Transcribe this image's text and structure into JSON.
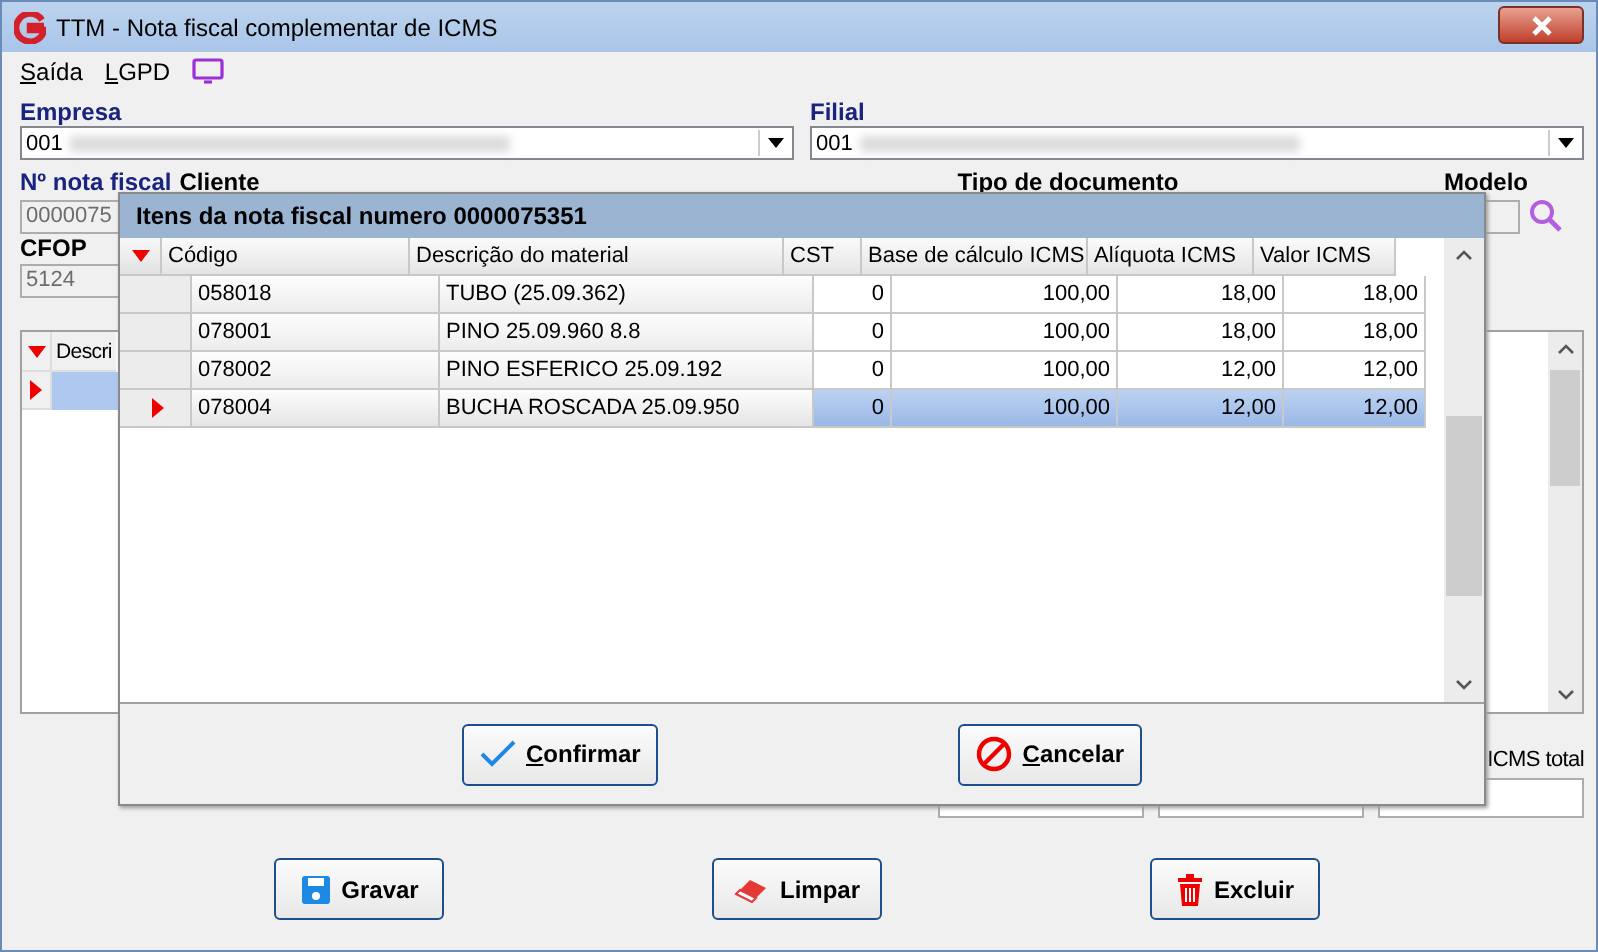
{
  "window": {
    "title": "TTM - Nota fiscal complementar de ICMS"
  },
  "menu": [
    {
      "accel": "S",
      "rest": "aída"
    },
    {
      "accel": "L",
      "rest": "GPD"
    }
  ],
  "empresa": {
    "label": "Empresa",
    "value": "001"
  },
  "filial": {
    "label": "Filial",
    "value": "001"
  },
  "labels": {
    "nota_fiscal": "Nº nota fiscal",
    "cliente": "Cliente",
    "tipo_documento": "Tipo de documento",
    "modelo": "Modelo",
    "cfop": "CFOP"
  },
  "nota_fiscal_value": "0000075",
  "cfop_value": "5124",
  "items_grid": {
    "columns": [
      "Descri"
    ],
    "rows": [
      {
        "selected": true
      }
    ]
  },
  "totals": {
    "label": "ICMS total"
  },
  "buttons": [
    {
      "label": "Gravar",
      "kind": "save"
    },
    {
      "label": "Limpar",
      "kind": "eraser"
    },
    {
      "label": "Excluir",
      "kind": "trash"
    }
  ],
  "dialog": {
    "title": "Itens da nota fiscal numero 0000075351",
    "columns": [
      "Código",
      "Descrição do material",
      "CST",
      "Base de cálculo ICMS",
      "Alíquota ICMS",
      "Valor ICMS"
    ],
    "rows": [
      {
        "cells": [
          "058018",
          "TUBO (25.09.362)",
          "0",
          "100,00",
          "18,00",
          "18,00"
        ],
        "selected": false
      },
      {
        "cells": [
          "078001",
          "PINO 25.09.960 8.8",
          "0",
          "100,00",
          "18,00",
          "18,00"
        ],
        "selected": false
      },
      {
        "cells": [
          "078002",
          "PINO ESFERICO 25.09.192",
          "0",
          "100,00",
          "12,00",
          "12,00"
        ],
        "selected": false
      },
      {
        "cells": [
          "078004",
          "BUCHA ROSCADA 25.09.950",
          "0",
          "100,00",
          "12,00",
          "12,00"
        ],
        "selected": true
      }
    ],
    "buttons": [
      {
        "accel": "C",
        "rest": "onfirmar",
        "kind": "confirm"
      },
      {
        "accel": "C",
        "rest": "ancelar",
        "kind": "cancel"
      }
    ]
  }
}
